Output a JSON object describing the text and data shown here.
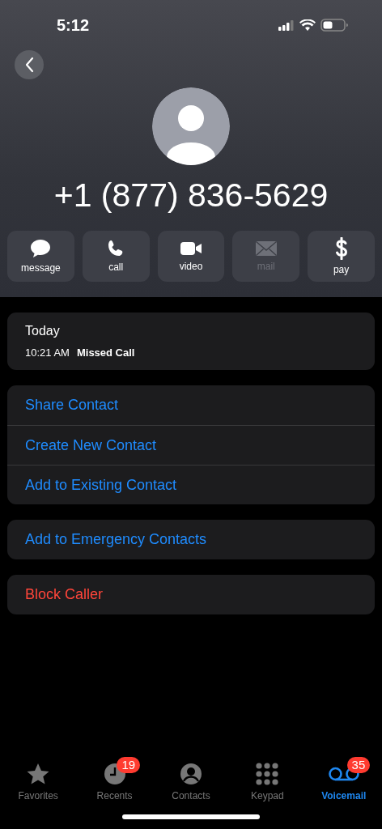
{
  "status_bar": {
    "time": "5:12"
  },
  "contact": {
    "number": "+1 (877) 836-5629"
  },
  "actions": [
    {
      "kind": "message",
      "label": "message",
      "disabled": false
    },
    {
      "kind": "call",
      "label": "call",
      "disabled": false
    },
    {
      "kind": "video",
      "label": "video",
      "disabled": false
    },
    {
      "kind": "mail",
      "label": "mail",
      "disabled": true
    },
    {
      "kind": "pay",
      "label": "pay",
      "disabled": false
    }
  ],
  "history": {
    "date": "Today",
    "entries": [
      {
        "time": "10:21 AM",
        "type": "Missed Call"
      }
    ]
  },
  "groups": [
    [
      {
        "label": "Share Contact",
        "kind": "link"
      },
      {
        "label": "Create New Contact",
        "kind": "link"
      },
      {
        "label": "Add to Existing Contact",
        "kind": "link"
      }
    ],
    [
      {
        "label": "Add to Emergency Contacts",
        "kind": "link"
      }
    ],
    [
      {
        "label": "Block Caller",
        "kind": "destructive"
      }
    ]
  ],
  "tabs": [
    {
      "kind": "favorites",
      "label": "Favorites",
      "selected": false
    },
    {
      "kind": "recents",
      "label": "Recents",
      "selected": false,
      "badge": "19"
    },
    {
      "kind": "contacts",
      "label": "Contacts",
      "selected": false
    },
    {
      "kind": "keypad",
      "label": "Keypad",
      "selected": false
    },
    {
      "kind": "voicemail",
      "label": "Voicemail",
      "selected": true,
      "badge": "35"
    }
  ]
}
